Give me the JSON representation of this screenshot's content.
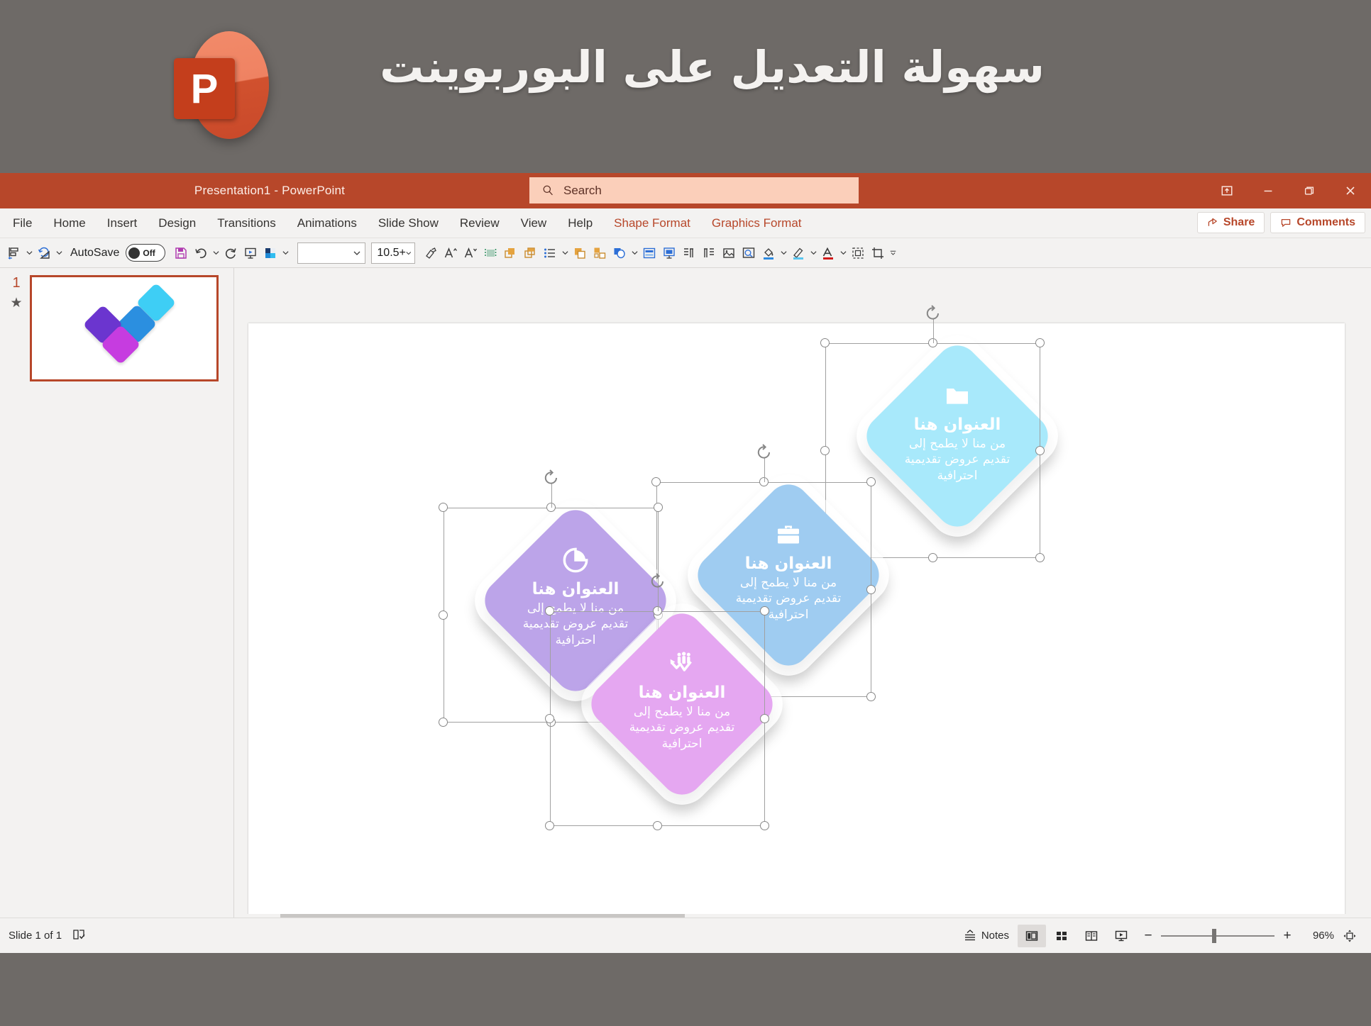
{
  "banner": {
    "title": "سهولة التعديل على البوربوينت",
    "logo_letter": "P",
    "logo_name": "powerpoint-logo"
  },
  "titlebar": {
    "document_title": "Presentation1  -  PowerPoint",
    "search_placeholder": "Search",
    "window_buttons": [
      {
        "name": "ribbon-display-options",
        "label": "Ribbon Display Options"
      },
      {
        "name": "minimize",
        "label": "Minimize"
      },
      {
        "name": "restore",
        "label": "Restore Down"
      },
      {
        "name": "close",
        "label": "Close"
      }
    ]
  },
  "ribbon": {
    "tabs": [
      {
        "label": "File",
        "contextual": false
      },
      {
        "label": "Home",
        "contextual": false
      },
      {
        "label": "Insert",
        "contextual": false
      },
      {
        "label": "Design",
        "contextual": false
      },
      {
        "label": "Transitions",
        "contextual": false
      },
      {
        "label": "Animations",
        "contextual": false
      },
      {
        "label": "Slide Show",
        "contextual": false
      },
      {
        "label": "Review",
        "contextual": false
      },
      {
        "label": "View",
        "contextual": false
      },
      {
        "label": "Help",
        "contextual": false
      },
      {
        "label": "Shape Format",
        "contextual": true
      },
      {
        "label": "Graphics Format",
        "contextual": true
      }
    ],
    "share_label": "Share",
    "comments_label": "Comments",
    "contextual_color": "#b7472a"
  },
  "toolbar": {
    "autosave_label": "AutoSave",
    "autosave_state": "Off",
    "font_name": "",
    "font_size": "10.5+",
    "items": [
      "align-objects-icon",
      "rotate-objects-icon",
      "save-icon",
      "undo-icon",
      "redo-icon",
      "start-slideshow-icon",
      "shape-fill-icon",
      "format-painter-icon",
      "increase-font-size-icon",
      "decrease-font-size-icon",
      "align-text-icon",
      "bring-forward-icon",
      "send-backward-icon",
      "bullets-icon",
      "duplicate-icon",
      "group-icon",
      "merge-shapes-icon",
      "layout-icon",
      "insert-placeholder-icon",
      "rtl-paragraph-icon",
      "ltr-paragraph-icon",
      "insert-picture-icon",
      "zoom-icon",
      "fill-color-icon",
      "line-color-icon",
      "font-color-icon",
      "selection-pane-icon",
      "crop-icon",
      "more-commands-icon"
    ]
  },
  "thumbnails": {
    "slides": [
      {
        "number": "1",
        "animation_marker": "★"
      }
    ]
  },
  "slide": {
    "shapes": [
      {
        "id": "shape-purple",
        "color": "#6b35cf",
        "icon": "pie-chart-icon",
        "title": "العنوان هنا",
        "body": "من منا لا يطمح إلى تقديم عروض تقديمية احترافية",
        "selected": true
      },
      {
        "id": "shape-magenta",
        "color": "#c63ce0",
        "icon": "people-growth-chart-icon",
        "title": "العنوان هنا",
        "body": "من منا لا يطمح إلى تقديم عروض تقديمية احترافية",
        "selected": true
      },
      {
        "id": "shape-blue",
        "color": "#2b8fe0",
        "icon": "briefcase-icon",
        "title": "العنوان هنا",
        "body": "من منا لا يطمح إلى تقديم عروض تقديمية احترافية",
        "selected": true
      },
      {
        "id": "shape-cyan",
        "color": "#3ecef5",
        "icon": "folder-icon",
        "title": "العنوان هنا",
        "body": "من منا لا يطمح إلى تقديم عروض تقديمية احترافية",
        "selected": true
      }
    ]
  },
  "statusbar": {
    "slide_count_text": "Slide 1 of 1",
    "accessibility_icon": "accessibility-checker-icon",
    "notes_label": "Notes",
    "views": [
      {
        "name": "normal-view",
        "label": "Normal",
        "active": true
      },
      {
        "name": "slide-sorter-view",
        "label": "Slide Sorter",
        "active": false
      },
      {
        "name": "reading-view",
        "label": "Reading View",
        "active": false
      },
      {
        "name": "slide-show-view",
        "label": "Slide Show",
        "active": false
      }
    ],
    "zoom_out_label": "−",
    "zoom_in_label": "+",
    "zoom_percent": "96%",
    "fit_label": "Fit slide to current window"
  }
}
